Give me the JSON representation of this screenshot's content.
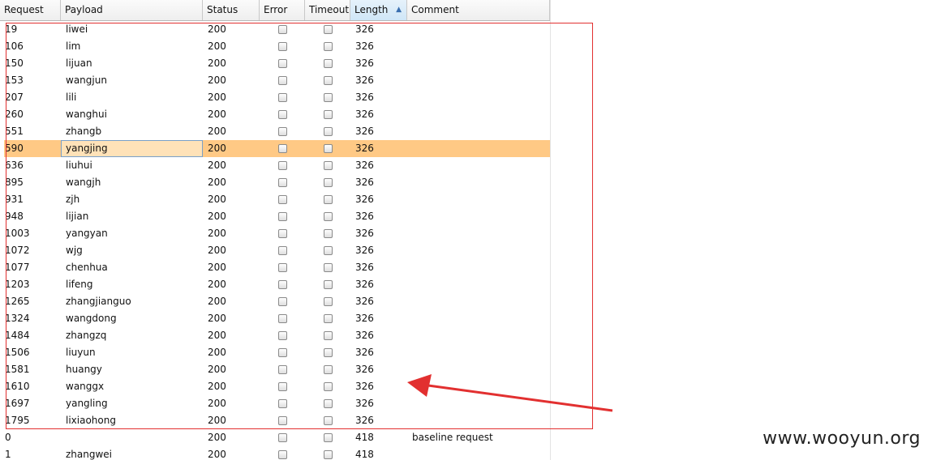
{
  "table": {
    "columns": [
      {
        "label": "Request",
        "width": 75
      },
      {
        "label": "Payload",
        "width": 175
      },
      {
        "label": "Status",
        "width": 70
      },
      {
        "label": "Error",
        "width": 56
      },
      {
        "label": "Timeout",
        "width": 56
      },
      {
        "label": "Length",
        "width": 70
      },
      {
        "label": "Comment",
        "width": 176
      }
    ],
    "sorted_column": "Length",
    "sort_direction": "ascending",
    "rows": [
      {
        "request": "19",
        "payload": "liwei",
        "status": "200",
        "length": "326",
        "comment": ""
      },
      {
        "request": "106",
        "payload": "lim",
        "status": "200",
        "length": "326",
        "comment": ""
      },
      {
        "request": "150",
        "payload": "lijuan",
        "status": "200",
        "length": "326",
        "comment": ""
      },
      {
        "request": "153",
        "payload": "wangjun",
        "status": "200",
        "length": "326",
        "comment": ""
      },
      {
        "request": "207",
        "payload": "lili",
        "status": "200",
        "length": "326",
        "comment": ""
      },
      {
        "request": "260",
        "payload": "wanghui",
        "status": "200",
        "length": "326",
        "comment": ""
      },
      {
        "request": "551",
        "payload": "zhangb",
        "status": "200",
        "length": "326",
        "comment": ""
      },
      {
        "request": "590",
        "payload": "yangjing",
        "status": "200",
        "length": "326",
        "comment": ""
      },
      {
        "request": "636",
        "payload": "liuhui",
        "status": "200",
        "length": "326",
        "comment": ""
      },
      {
        "request": "895",
        "payload": "wangjh",
        "status": "200",
        "length": "326",
        "comment": ""
      },
      {
        "request": "931",
        "payload": "zjh",
        "status": "200",
        "length": "326",
        "comment": ""
      },
      {
        "request": "948",
        "payload": "lijian",
        "status": "200",
        "length": "326",
        "comment": ""
      },
      {
        "request": "1003",
        "payload": "yangyan",
        "status": "200",
        "length": "326",
        "comment": ""
      },
      {
        "request": "1072",
        "payload": "wjg",
        "status": "200",
        "length": "326",
        "comment": ""
      },
      {
        "request": "1077",
        "payload": "chenhua",
        "status": "200",
        "length": "326",
        "comment": ""
      },
      {
        "request": "1203",
        "payload": "lifeng",
        "status": "200",
        "length": "326",
        "comment": ""
      },
      {
        "request": "1265",
        "payload": "zhangjianguo",
        "status": "200",
        "length": "326",
        "comment": ""
      },
      {
        "request": "1324",
        "payload": "wangdong",
        "status": "200",
        "length": "326",
        "comment": ""
      },
      {
        "request": "1484",
        "payload": "zhangzq",
        "status": "200",
        "length": "326",
        "comment": ""
      },
      {
        "request": "1506",
        "payload": "liuyun",
        "status": "200",
        "length": "326",
        "comment": ""
      },
      {
        "request": "1581",
        "payload": "huangy",
        "status": "200",
        "length": "326",
        "comment": ""
      },
      {
        "request": "1610",
        "payload": "wanggx",
        "status": "200",
        "length": "326",
        "comment": ""
      },
      {
        "request": "1697",
        "payload": "yangling",
        "status": "200",
        "length": "326",
        "comment": ""
      },
      {
        "request": "1795",
        "payload": "lixiaohong",
        "status": "200",
        "length": "326",
        "comment": ""
      },
      {
        "request": "0",
        "payload": "",
        "status": "200",
        "length": "418",
        "comment": "baseline request"
      },
      {
        "request": "1",
        "payload": "zhangwei",
        "status": "200",
        "length": "418",
        "comment": ""
      }
    ],
    "selected_row": 7
  },
  "colors": {
    "selection": "#ffc985",
    "annotation": "#e23030"
  },
  "annotation": {
    "highlighted_rows": "first 24 rows (length 326)"
  },
  "watermark": "www.wooyun.org"
}
